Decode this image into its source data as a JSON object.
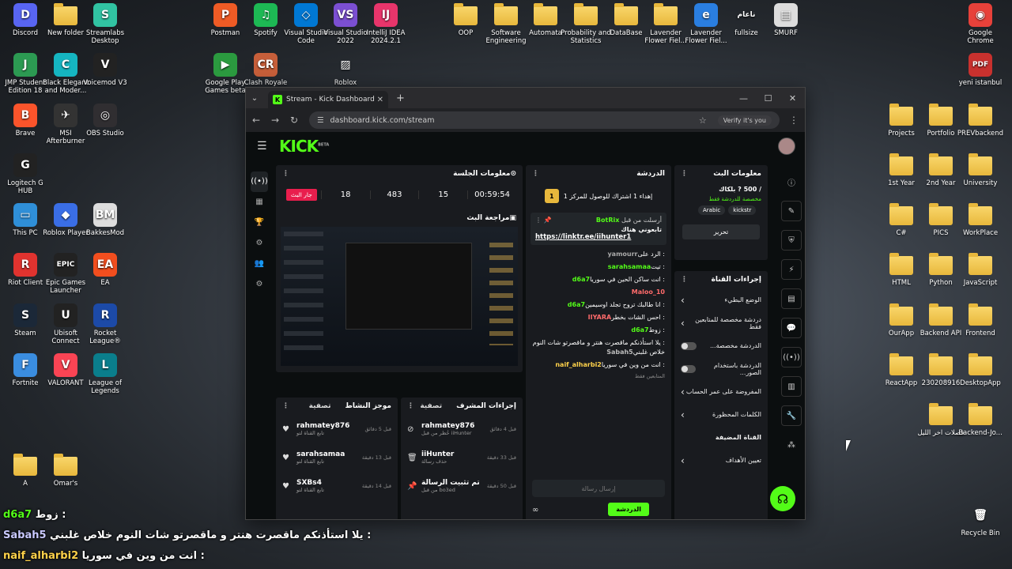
{
  "desktop_icons": [
    {
      "label": "Discord",
      "color": "#5865f2",
      "glyph": "D"
    },
    {
      "label": "New folder",
      "folder": true
    },
    {
      "label": "Streamlabs Desktop",
      "color": "#31c3a2",
      "glyph": "S"
    },
    {
      "label": "Postman",
      "color": "#ef5b25",
      "glyph": "P"
    },
    {
      "label": "Spotify",
      "color": "#1db954",
      "glyph": "♫"
    },
    {
      "label": "Visual Studio Code",
      "color": "#0078d4",
      "glyph": "◇"
    },
    {
      "label": "Visual Studio 2022",
      "color": "#7b4fd2",
      "glyph": "VS"
    },
    {
      "label": "IntelliJ IDEA 2024.2.1",
      "color": "#e8356b",
      "glyph": "IJ"
    },
    {
      "label": "OOP",
      "folder": true
    },
    {
      "label": "Software Engineering",
      "folder": true
    },
    {
      "label": "Automata",
      "folder": true
    },
    {
      "label": "Probability and Statistics",
      "folder": true
    },
    {
      "label": "DataBase",
      "folder": true
    },
    {
      "label": "Lavender Flower Fiel...",
      "folder": true
    },
    {
      "label": "Lavender Flower Fiel...",
      "color": "#2a7ee0",
      "glyph": "e"
    },
    {
      "label": "fullsize",
      "color": "transparent",
      "glyph": "ناعام"
    },
    {
      "label": "SMURF",
      "color": "#ddd",
      "glyph": "▤"
    },
    {
      "label": "Google Chrome",
      "color": "#e7413a",
      "glyph": "◉"
    },
    {
      "label": "JMP Student Edition 18",
      "color": "#2c9a52",
      "glyph": "J"
    },
    {
      "label": "Black Elegant and Moder...",
      "color": "#15b5c1",
      "glyph": "C"
    },
    {
      "label": "Voicemod V3",
      "color": "#222",
      "glyph": "V"
    },
    {
      "label": "Google Play Games beta",
      "color": "#2b9a3f",
      "glyph": "▶"
    },
    {
      "label": "Clash Royale",
      "color": "#c75f3a",
      "glyph": "CR"
    },
    {
      "label": "Roblox",
      "color": "transparent",
      "glyph": "▨"
    },
    {
      "label": "yeni istanbul",
      "color": "#c8312e",
      "glyph": "PDF"
    },
    {
      "label": "Brave",
      "color": "#fb542b",
      "glyph": "B"
    },
    {
      "label": "MSI Afterburner",
      "color": "#333",
      "glyph": "✈"
    },
    {
      "label": "OBS Studio",
      "color": "#302e31",
      "glyph": "◎"
    },
    {
      "label": "Projects",
      "folder": true
    },
    {
      "label": "Portfolio",
      "folder": true
    },
    {
      "label": "PREVbackend",
      "folder": true
    },
    {
      "label": "Logitech G HUB",
      "color": "#222",
      "glyph": "G"
    },
    {
      "label": "1st Year",
      "folder": true
    },
    {
      "label": "2nd Year",
      "folder": true
    },
    {
      "label": "University",
      "folder": true
    },
    {
      "label": "This PC",
      "color": "#2f8fd8",
      "glyph": "▭"
    },
    {
      "label": "Roblox Player",
      "color": "#3a6ee6",
      "glyph": "◆"
    },
    {
      "label": "BakkesMod",
      "color": "#ddd",
      "glyph": "BM"
    },
    {
      "label": "C#",
      "folder": true
    },
    {
      "label": "PICS",
      "folder": true
    },
    {
      "label": "WorkPlace",
      "folder": true
    },
    {
      "label": "Riot Client",
      "color": "#e0332f",
      "glyph": "R"
    },
    {
      "label": "Epic Games Launcher",
      "color": "#222",
      "glyph": "EPIC"
    },
    {
      "label": "EA",
      "color": "#f24e1e",
      "glyph": "EA"
    },
    {
      "label": "HTML",
      "folder": true
    },
    {
      "label": "Python",
      "folder": true
    },
    {
      "label": "JavaScript",
      "folder": true
    },
    {
      "label": "Steam",
      "color": "#1b2838",
      "glyph": "S"
    },
    {
      "label": "Ubisoft Connect",
      "color": "#222",
      "glyph": "U"
    },
    {
      "label": "Rocket League®",
      "color": "#1c4aa8",
      "glyph": "R"
    },
    {
      "label": "OurApp",
      "folder": true
    },
    {
      "label": "Backend API",
      "folder": true
    },
    {
      "label": "Frontend",
      "folder": true
    },
    {
      "label": "Fortnite",
      "color": "#3a8de0",
      "glyph": "F"
    },
    {
      "label": "VALORANT",
      "color": "#fa4454",
      "glyph": "V"
    },
    {
      "label": "League of Legends",
      "color": "#0a7e8c",
      "glyph": "L"
    },
    {
      "label": "ReactApp",
      "folder": true
    },
    {
      "label": "230208916",
      "folder": true
    },
    {
      "label": "DesktopApp",
      "folder": true
    },
    {
      "label": "فصلات اخر الليل",
      "folder": true
    },
    {
      "label": "Backend-Jo...",
      "folder": true
    },
    {
      "label": "A",
      "folder": true
    },
    {
      "label": "Omar's",
      "folder": true
    },
    {
      "label": "Recycle Bin",
      "color": "transparent",
      "glyph": "🗑"
    }
  ],
  "browser": {
    "tab_title": "Stream - Kick Dashboard",
    "url": "dashboard.kick.com/stream",
    "verify_label": "Verify it's you"
  },
  "kick": {
    "logo": "KICK",
    "logo_tag": "BETA",
    "session_panel": {
      "title": "معلومات الجلسة",
      "live_label": "جار البث",
      "stats": [
        "18",
        "483",
        "15",
        "00:59:54"
      ]
    },
    "preview_title": "مراجعة البث",
    "activity": {
      "title": "موجز النشاط",
      "filter": "تصفية",
      "items": [
        {
          "name": "rahmatey876",
          "sub": "تابع القناة لتو",
          "time": "قبل 5 دقائق"
        },
        {
          "name": "sarahsamaa",
          "sub": "تابع القناة لتو",
          "time": "قبل 13 دقيقة"
        },
        {
          "name": "SXBs4",
          "sub": "تابع القناة لتو",
          "time": "قبل 14 دقيقة"
        }
      ]
    },
    "mod_actions": {
      "title": "إجراءات المشرف",
      "filter": "تصفية",
      "items": [
        {
          "name": "rahmatey876",
          "sub": "حُظر من قبل iiHunter",
          "time": "قبل 4 دقائق"
        },
        {
          "name": "iiHunter",
          "sub": "حذف رسالة",
          "time": "قبل 33 دقيقة"
        },
        {
          "name": "تم تثبيت الرسالة",
          "sub": "من قبل bo3ed",
          "time": "قبل 50 دقيقة"
        }
      ]
    },
    "chat": {
      "title": "الدردشة",
      "goal": "إهداء 1 اشتراك للوصول للمركز 1",
      "goal_rank": "1",
      "pinned_by": "BotRix",
      "pinned_prefix": "أرسلت من قبل",
      "pinned_text": "تابعوني هناك",
      "pinned_link": "https://linktr.ee/iihunter1",
      "messages": [
        {
          "user": "yamourr",
          "text": "الرد على",
          "color": "#aaa"
        },
        {
          "user": "sarahsamaa",
          "text": "تيت",
          "color": "#53fc18"
        },
        {
          "user": "d6a7",
          "text": "انت ساكن الحين في سوريا",
          "color": "#53fc18"
        },
        {
          "user": "Maloo_10",
          "text": "",
          "color": "#ff6b6b"
        },
        {
          "user": "d6a7",
          "text": "انا طالبك تروح تجلد اوسيمين",
          "color": "#53fc18"
        },
        {
          "user": "IIYARA",
          "text": "احس الشات بخطر",
          "color": "#ff6b6b"
        },
        {
          "user": "d6a7",
          "text": "زوط",
          "color": "#53fc18"
        },
        {
          "user": "Sabah5",
          "text": "يلا استأذنكم ماقصرت هنتر و ماقصرتو شات النوم خلاص غلبني",
          "color": "#bbb"
        },
        {
          "user": "naif_alharbi2",
          "text": "انت من وين في سوريا",
          "color": "#ffd24a"
        }
      ],
      "followers_only": "المتابعين فقط",
      "input_placeholder": "إرسال رسالة",
      "send_label": "الدردشة"
    },
    "stream_info": {
      "title": "معلومات البث",
      "stream_title": "/ 500 ? بلكاك",
      "subtitle": "مخصصة للدردشة فقط",
      "tags": [
        "Arabic",
        "kickstr"
      ],
      "edit_label": "تحرير"
    },
    "channel_actions": {
      "title": "إجراءات القناة",
      "rows": [
        {
          "label": "الوضع البطيء",
          "type": "arrow"
        },
        {
          "label": "دردشة مخصصة للمتابعين فقط",
          "type": "arrow"
        },
        {
          "label": "الدردشة مخصصة...",
          "type": "toggle"
        },
        {
          "label": "الدردشة باستخدام الصور...",
          "type": "toggle"
        },
        {
          "label": "المفروضة على عمر الحساب",
          "type": "arrow"
        },
        {
          "label": "الكلمات المحظورة",
          "type": "arrow"
        },
        {
          "label": "القناة المضيفة",
          "type": "none"
        },
        {
          "label": "تعيين الأهداف",
          "type": "arrow"
        }
      ]
    }
  },
  "overlay_chat": [
    {
      "user": "d6a7",
      "text": "زوط :",
      "color": "#53fc18"
    },
    {
      "user": "Sabah5",
      "text": "يلا استأذنكم ماقصرت هنتر و ماقصرتو شات النوم خلاص غلبني :",
      "color": "#c9c9ff"
    },
    {
      "user": "naif_alharbi2",
      "text": "انت من وين في سوريا :",
      "color": "#ffd24a"
    }
  ]
}
